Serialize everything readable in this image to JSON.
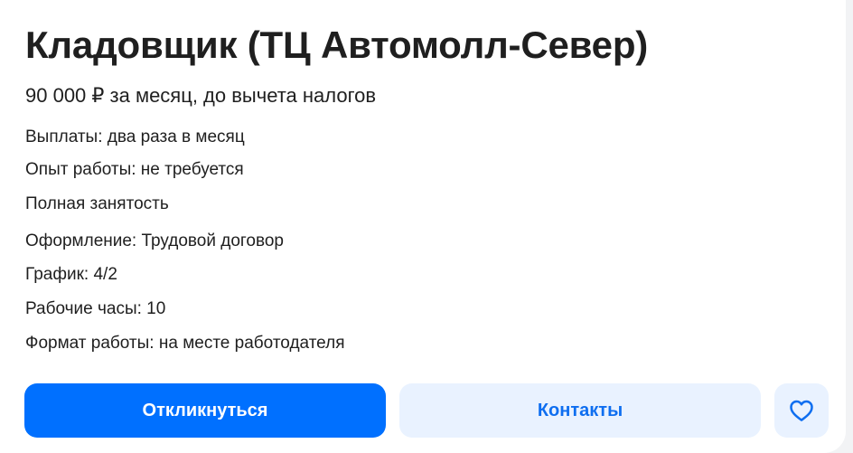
{
  "vacancy": {
    "title": "Кладовщик (ТЦ Автомолл-Север)",
    "salary": "90 000 ₽ за месяц, до вычета налогов",
    "details": [
      "Выплаты: два раза в месяц",
      "Опыт работы: не требуется",
      "Полная занятость",
      "Оформление: Трудовой договор",
      "График: 4/2",
      "Рабочие часы: 10",
      "Формат работы: на месте работодателя"
    ]
  },
  "actions": {
    "respond_label": "Откликнуться",
    "contacts_label": "Контакты",
    "favorite_icon": "heart-outline-icon"
  },
  "colors": {
    "primary": "#0070ff",
    "secondary_bg": "#e9f2ff",
    "secondary_text": "#0e6ef0",
    "text": "#1f1f1f"
  }
}
